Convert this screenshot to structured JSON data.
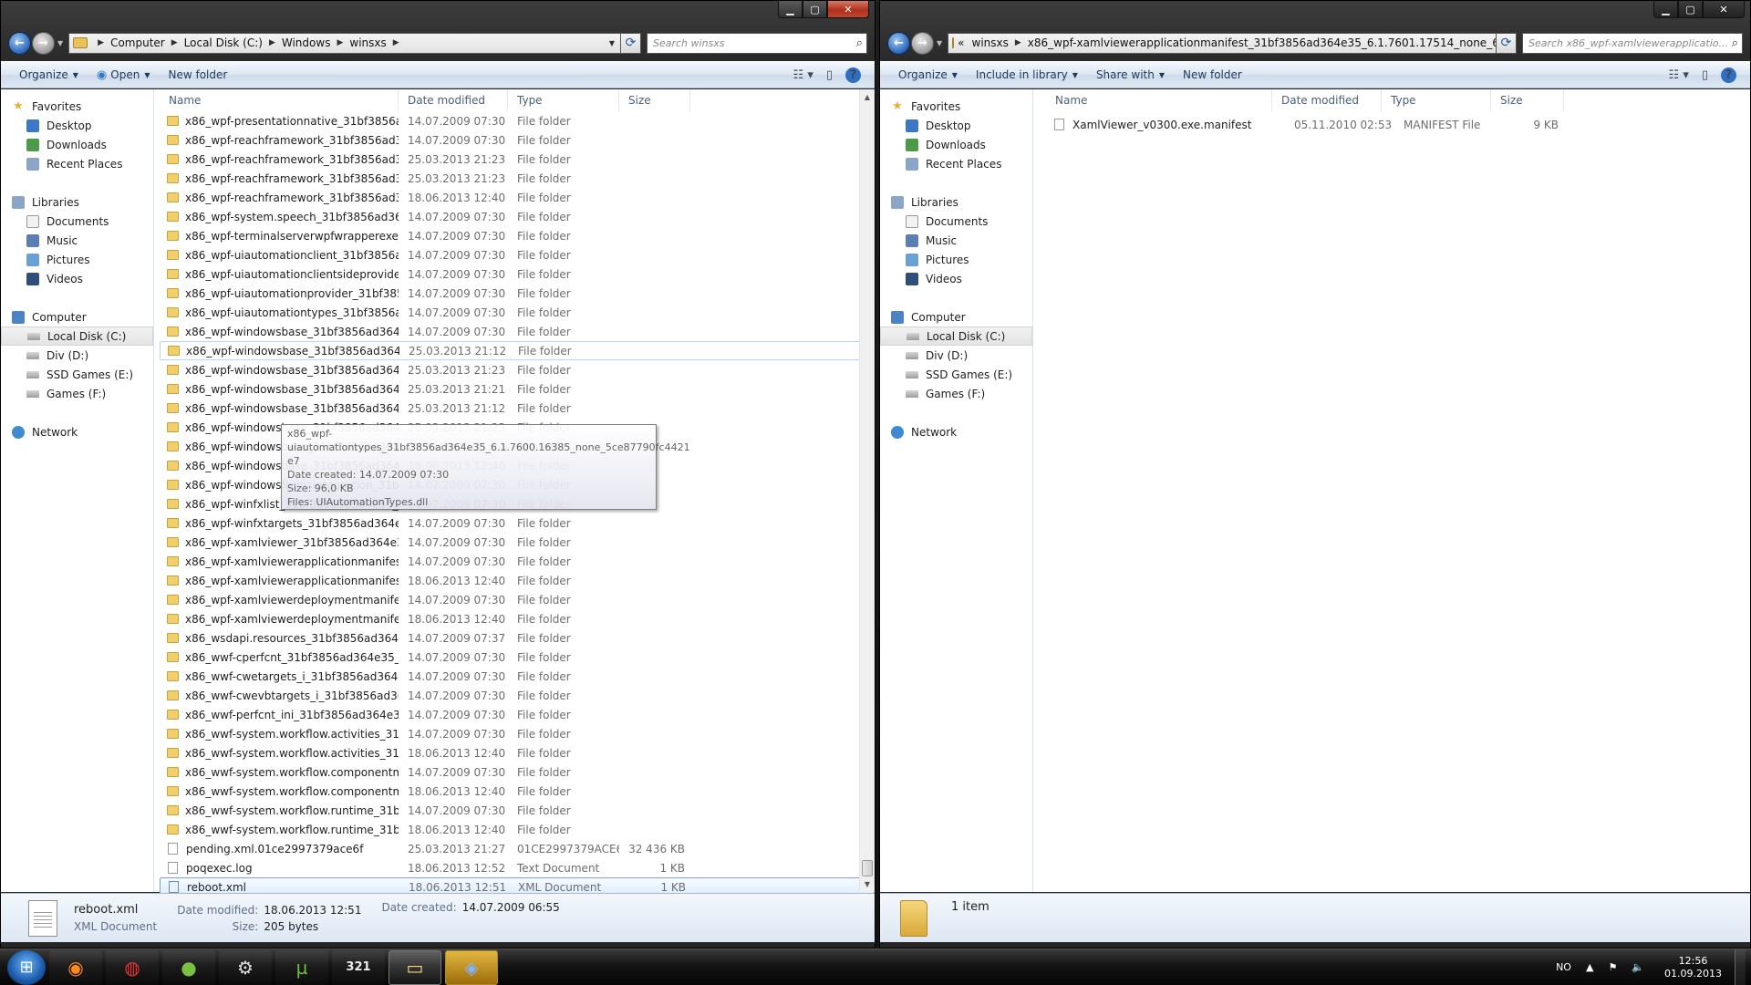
{
  "left": {
    "nav": {
      "back": "back",
      "forward": "forward"
    },
    "breadcrumb": [
      "Computer",
      "Local Disk (C:)",
      "Windows",
      "winsxs"
    ],
    "search_placeholder": "Search winsxs",
    "toolbar": {
      "organize": "Organize",
      "open": "Open",
      "new_folder": "New folder"
    },
    "columns": {
      "name": "Name",
      "date": "Date modified",
      "type": "Type",
      "size": "Size"
    },
    "files": [
      {
        "name": "x86_wpf-presentationnative_31bf3856ad3...",
        "date": "14.07.2009 07:30",
        "type": "File folder",
        "size": "",
        "kind": "folder"
      },
      {
        "name": "x86_wpf-reachframework_31bf3856ad364...",
        "date": "14.07.2009 07:30",
        "type": "File folder",
        "size": "",
        "kind": "folder"
      },
      {
        "name": "x86_wpf-reachframework_31bf3856ad364...",
        "date": "25.03.2013 21:23",
        "type": "File folder",
        "size": "",
        "kind": "folder"
      },
      {
        "name": "x86_wpf-reachframework_31bf3856ad364...",
        "date": "25.03.2013 21:23",
        "type": "File folder",
        "size": "",
        "kind": "folder"
      },
      {
        "name": "x86_wpf-reachframework_31bf3856ad364...",
        "date": "18.06.2013 12:40",
        "type": "File folder",
        "size": "",
        "kind": "folder"
      },
      {
        "name": "x86_wpf-system.speech_31bf3856ad364e...",
        "date": "14.07.2009 07:30",
        "type": "File folder",
        "size": "",
        "kind": "folder"
      },
      {
        "name": "x86_wpf-terminalserverwpfwrapperexe_3...",
        "date": "14.07.2009 07:30",
        "type": "File folder",
        "size": "",
        "kind": "folder"
      },
      {
        "name": "x86_wpf-uiautomationclient_31bf3856ad...",
        "date": "14.07.2009 07:30",
        "type": "File folder",
        "size": "",
        "kind": "folder"
      },
      {
        "name": "x86_wpf-uiautomationclientsideprovider...",
        "date": "14.07.2009 07:30",
        "type": "File folder",
        "size": "",
        "kind": "folder"
      },
      {
        "name": "x86_wpf-uiautomationprovider_31bf3856...",
        "date": "14.07.2009 07:30",
        "type": "File folder",
        "size": "",
        "kind": "folder"
      },
      {
        "name": "x86_wpf-uiautomationtypes_31bf3856ad...",
        "date": "14.07.2009 07:30",
        "type": "File folder",
        "size": "",
        "kind": "folder"
      },
      {
        "name": "x86_wpf-windowsbase_31bf3856ad364e3...",
        "date": "14.07.2009 07:30",
        "type": "File folder",
        "size": "",
        "kind": "folder"
      },
      {
        "name": "x86_wpf-windowsbase_31bf3856ad364e3...",
        "date": "25.03.2013 21:12",
        "type": "File folder",
        "size": "",
        "kind": "folder",
        "hover": true
      },
      {
        "name": "x86_wpf-windowsbase_31bf3856ad364e3...",
        "date": "25.03.2013 21:23",
        "type": "File folder",
        "size": "",
        "kind": "folder"
      },
      {
        "name": "x86_wpf-windowsbase_31bf3856ad364e3...",
        "date": "25.03.2013 21:21",
        "type": "File folder",
        "size": "",
        "kind": "folder"
      },
      {
        "name": "x86_wpf-windowsbase_31bf3856ad364e3...",
        "date": "25.03.2013 21:12",
        "type": "File folder",
        "size": "",
        "kind": "folder"
      },
      {
        "name": "x86_wpf-windowsbase_31bf3856ad364e3...",
        "date": "25.03.2013 21:23",
        "type": "File folder",
        "size": "",
        "kind": "folder"
      },
      {
        "name": "x86_wpf-windowsbase_31bf3856ad364e3...",
        "date": "25.03.2013 21:21",
        "type": "File folder",
        "size": "",
        "kind": "folder"
      },
      {
        "name": "x86_wpf-windowsbase_31bf3856ad364e3...",
        "date": "18.06.2013 12:40",
        "type": "File folder",
        "size": "",
        "kind": "folder"
      },
      {
        "name": "x86_wpf-windowsformsintegration_31bf3...",
        "date": "14.07.2009 07:30",
        "type": "File folder",
        "size": "",
        "kind": "folder"
      },
      {
        "name": "x86_wpf-winfxlist_31bf3856ad364e35_6.1....",
        "date": "14.07.2009 07:30",
        "type": "File folder",
        "size": "",
        "kind": "folder"
      },
      {
        "name": "x86_wpf-winfxtargets_31bf3856ad364e35_...",
        "date": "14.07.2009 07:30",
        "type": "File folder",
        "size": "",
        "kind": "folder"
      },
      {
        "name": "x86_wpf-xamlviewer_31bf3856ad364e35_...",
        "date": "14.07.2009 07:30",
        "type": "File folder",
        "size": "",
        "kind": "folder"
      },
      {
        "name": "x86_wpf-xamlviewerapplicationmanifest_...",
        "date": "14.07.2009 07:30",
        "type": "File folder",
        "size": "",
        "kind": "folder"
      },
      {
        "name": "x86_wpf-xamlviewerapplicationmanifest_...",
        "date": "18.06.2013 12:40",
        "type": "File folder",
        "size": "",
        "kind": "folder"
      },
      {
        "name": "x86_wpf-xamlviewerdeploymentmanifest...",
        "date": "14.07.2009 07:30",
        "type": "File folder",
        "size": "",
        "kind": "folder"
      },
      {
        "name": "x86_wpf-xamlviewerdeploymentmanifest...",
        "date": "18.06.2013 12:40",
        "type": "File folder",
        "size": "",
        "kind": "folder"
      },
      {
        "name": "x86_wsdapi.resources_31bf3856ad364e35...",
        "date": "14.07.2009 07:37",
        "type": "File folder",
        "size": "",
        "kind": "folder"
      },
      {
        "name": "x86_wwf-cperfcnt_31bf3856ad364e35_6.1....",
        "date": "14.07.2009 07:30",
        "type": "File folder",
        "size": "",
        "kind": "folder"
      },
      {
        "name": "x86_wwf-cwetargets_i_31bf3856ad364e35...",
        "date": "14.07.2009 07:30",
        "type": "File folder",
        "size": "",
        "kind": "folder"
      },
      {
        "name": "x86_wwf-cwevbtargets_i_31bf3856ad364e...",
        "date": "14.07.2009 07:30",
        "type": "File folder",
        "size": "",
        "kind": "folder"
      },
      {
        "name": "x86_wwf-perfcnt_ini_31bf3856ad364e35_6...",
        "date": "14.07.2009 07:30",
        "type": "File folder",
        "size": "",
        "kind": "folder"
      },
      {
        "name": "x86_wwf-system.workflow.activities_31bf...",
        "date": "14.07.2009 07:30",
        "type": "File folder",
        "size": "",
        "kind": "folder"
      },
      {
        "name": "x86_wwf-system.workflow.activities_31bf...",
        "date": "18.06.2013 12:40",
        "type": "File folder",
        "size": "",
        "kind": "folder"
      },
      {
        "name": "x86_wwf-system.workflow.componentm...",
        "date": "14.07.2009 07:30",
        "type": "File folder",
        "size": "",
        "kind": "folder"
      },
      {
        "name": "x86_wwf-system.workflow.componentm...",
        "date": "18.06.2013 12:40",
        "type": "File folder",
        "size": "",
        "kind": "folder"
      },
      {
        "name": "x86_wwf-system.workflow.runtime_31bf3...",
        "date": "14.07.2009 07:30",
        "type": "File folder",
        "size": "",
        "kind": "folder"
      },
      {
        "name": "x86_wwf-system.workflow.runtime_31bf3...",
        "date": "18.06.2013 12:40",
        "type": "File folder",
        "size": "",
        "kind": "folder"
      },
      {
        "name": "pending.xml.01ce2997379ace6f",
        "date": "25.03.2013 21:27",
        "type": "01CE2997379ACE6...",
        "size": "32 436 KB",
        "kind": "file"
      },
      {
        "name": "poqexec.log",
        "date": "18.06.2013 12:52",
        "type": "Text Document",
        "size": "1 KB",
        "kind": "file"
      },
      {
        "name": "reboot.xml",
        "date": "18.06.2013 12:51",
        "type": "XML Document",
        "size": "1 KB",
        "kind": "xml",
        "selected": true
      }
    ],
    "tooltip": {
      "line1": "x86_wpf-",
      "line2": "uiautomationtypes_31bf3856ad364e35_6.1.7600.16385_none_5ce87790fc4421",
      "line3": "e7",
      "line4": "Date created: 14.07.2009 07:30",
      "line5": "Size: 96,0 KB",
      "line6": "Files: UIAutomationTypes.dll"
    },
    "details": {
      "name": "reboot.xml",
      "type": "XML Document",
      "modified_label": "Date modified:",
      "modified_value": "18.06.2013 12:51",
      "size_label": "Size:",
      "size_value": "205 bytes",
      "created_label": "Date created:",
      "created_value": "14.07.2009 06:55"
    }
  },
  "right": {
    "breadcrumb": [
      "x86_wpf-xamlviewerapplicationmanifest_31bf3856ad364e35_6.1.7601.17514_none_6..."
    ],
    "breadcrumb_prefix": "«",
    "breadcrumb_first": "winsxs",
    "search_placeholder": "Search x86_wpf-xamlviewerapplicatio...",
    "toolbar": {
      "organize": "Organize",
      "include": "Include in library",
      "share": "Share with",
      "new_folder": "New folder"
    },
    "columns": {
      "name": "Name",
      "date": "Date modified",
      "type": "Type",
      "size": "Size"
    },
    "files": [
      {
        "name": "XamlViewer_v0300.exe.manifest",
        "date": "05.11.2010 02:53",
        "type": "MANIFEST File",
        "size": "9 KB"
      }
    ],
    "details": {
      "count": "1 item"
    }
  },
  "navpane": {
    "favorites": "Favorites",
    "desktop": "Desktop",
    "downloads": "Downloads",
    "recent": "Recent Places",
    "libraries": "Libraries",
    "documents": "Documents",
    "music": "Music",
    "pictures": "Pictures",
    "videos": "Videos",
    "computer": "Computer",
    "local_disk": "Local Disk (C:)",
    "div": "Div (D:)",
    "ssd": "SSD Games (E:)",
    "games": "Games (F:)",
    "network": "Network"
  },
  "taskbar": {
    "lang": "NO",
    "time": "12:56",
    "date": "01.09.2013",
    "calendar_day": "321"
  }
}
